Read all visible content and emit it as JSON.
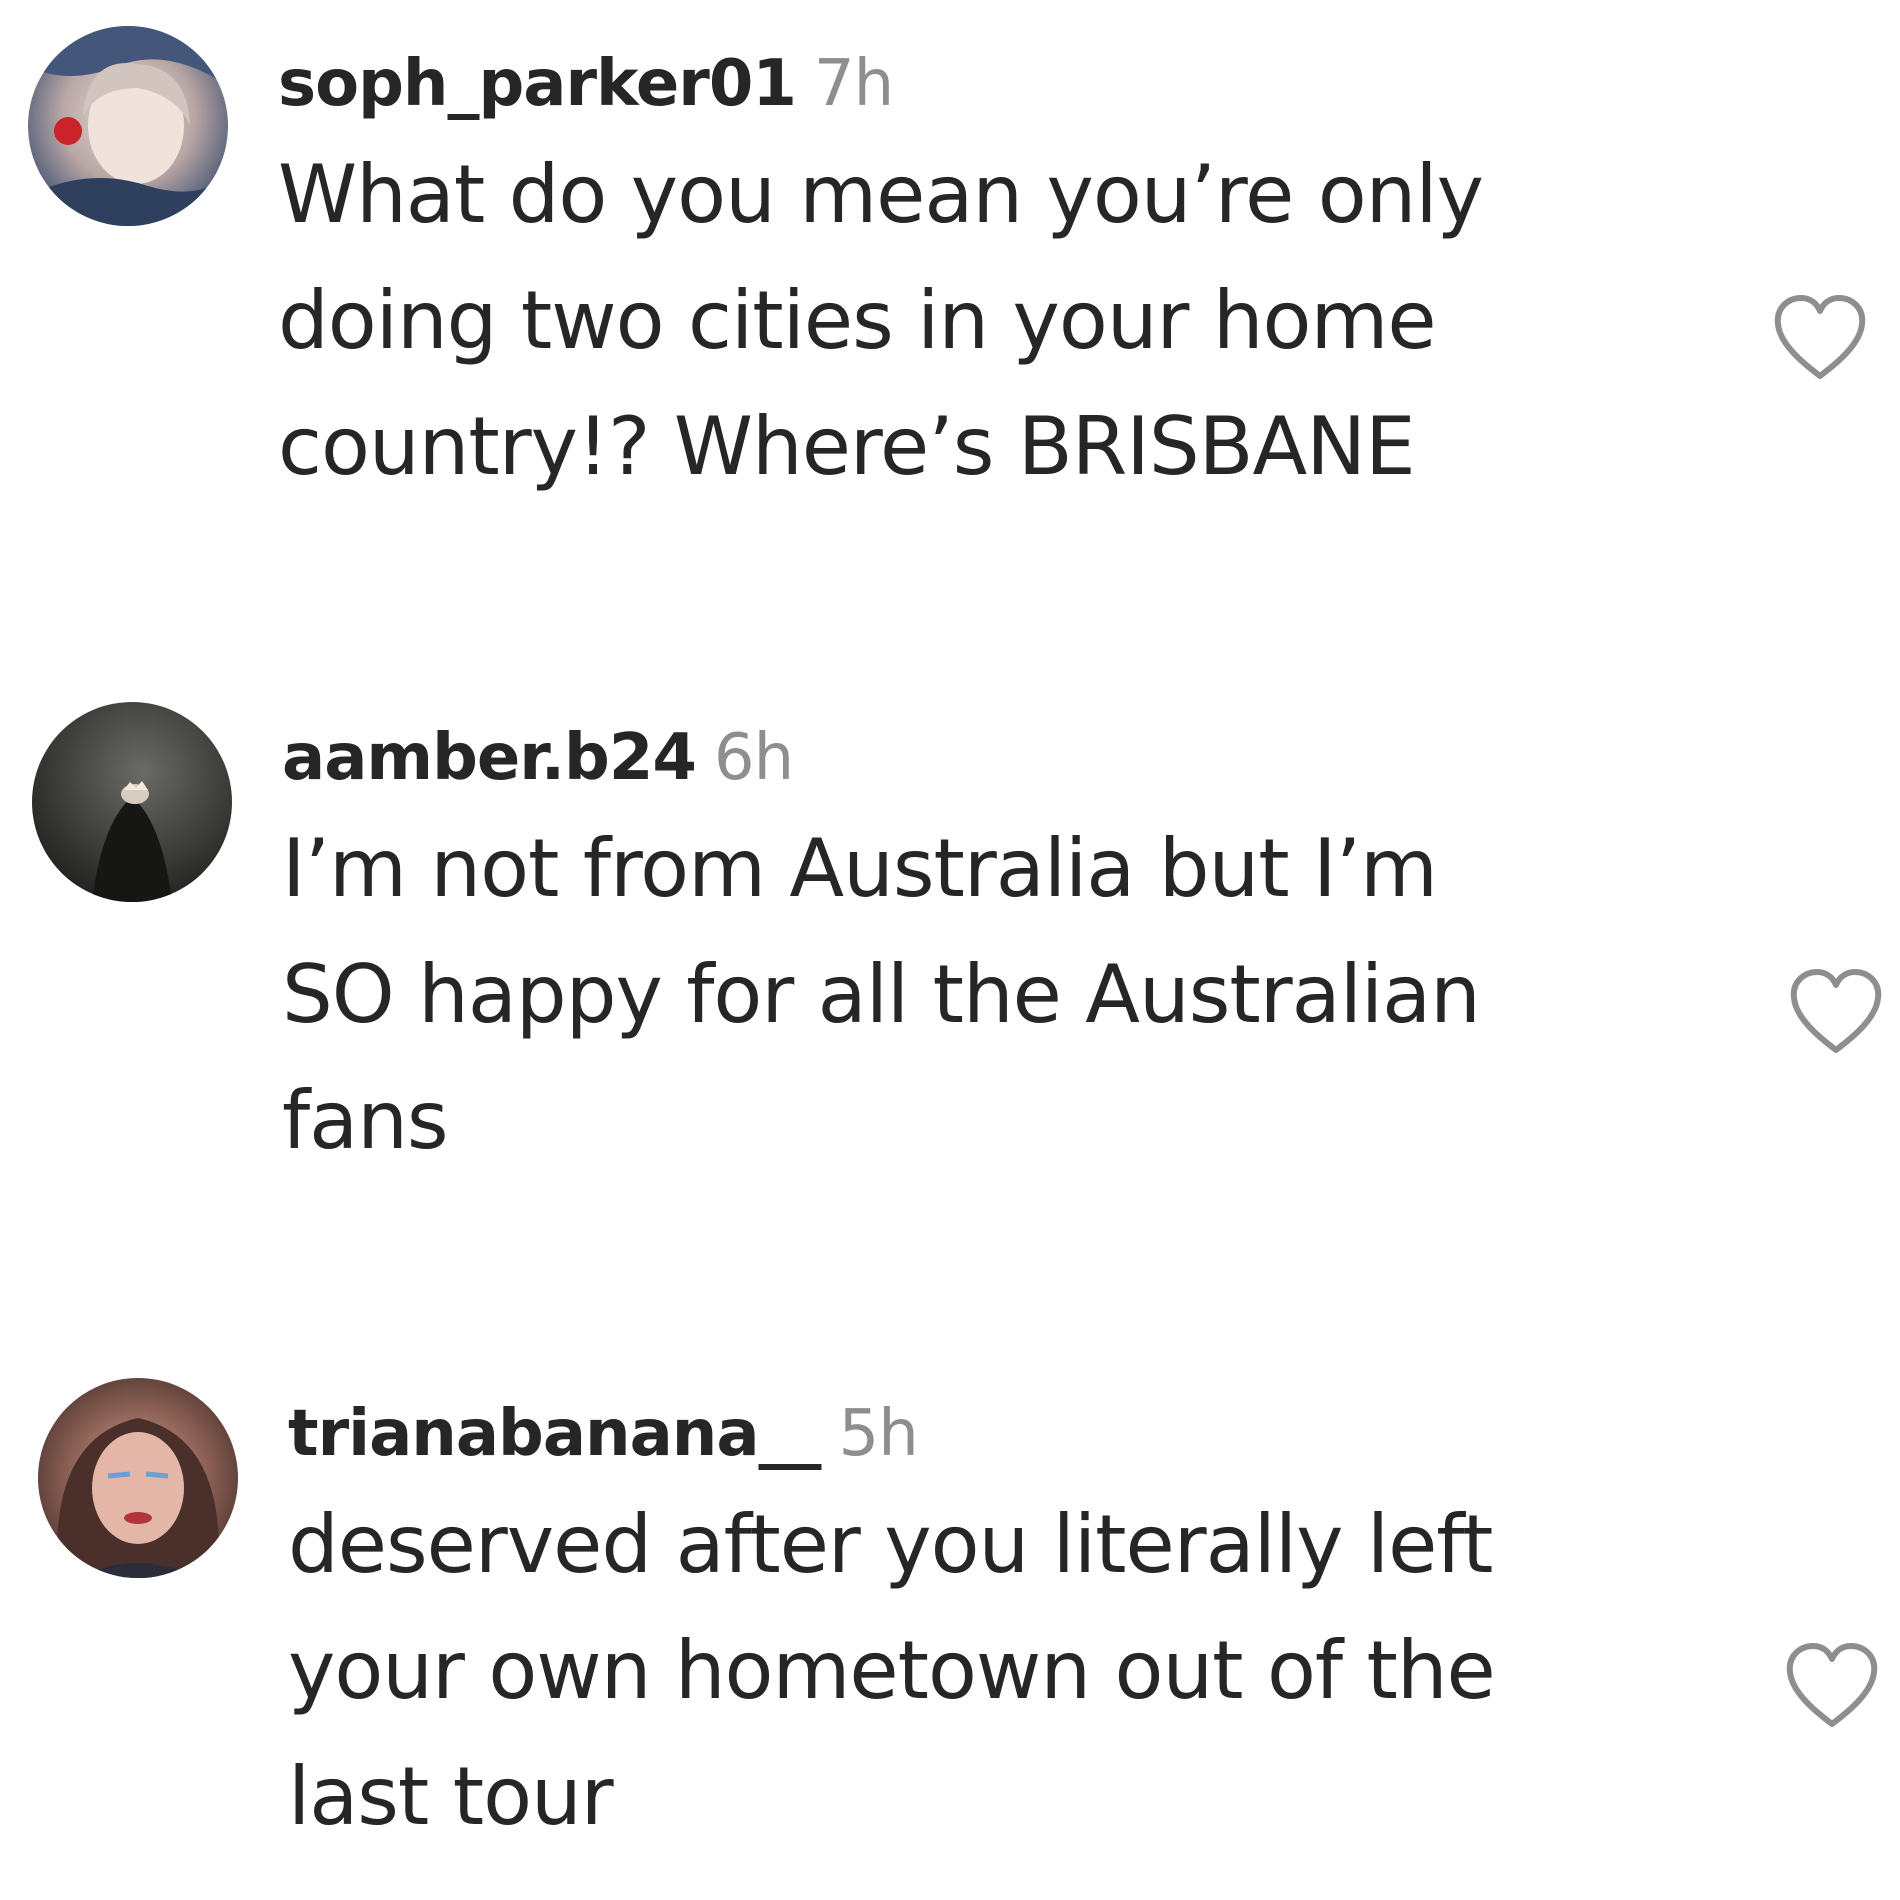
{
  "comments": [
    {
      "username": "soph_parker01",
      "time": "7h",
      "lines": [
        "What do you mean you’re only",
        "doing two cities in your home",
        "country!? Where’s BRISBANE"
      ]
    },
    {
      "username": "aamber.b24",
      "time": "6h",
      "lines": [
        "I’m not from Australia but I’m",
        "SO happy for all the Australian",
        "fans"
      ]
    },
    {
      "username": "trianabanana__",
      "time": "5h",
      "lines": [
        "deserved after you literally left",
        "your own hometown out of the",
        "last tour"
      ]
    }
  ],
  "icons": {
    "like": "heart-outline-icon"
  },
  "colors": {
    "text": "#262626",
    "timestamp": "#8e8e8e",
    "icon": "#8e8e8e",
    "background": "#ffffff"
  }
}
